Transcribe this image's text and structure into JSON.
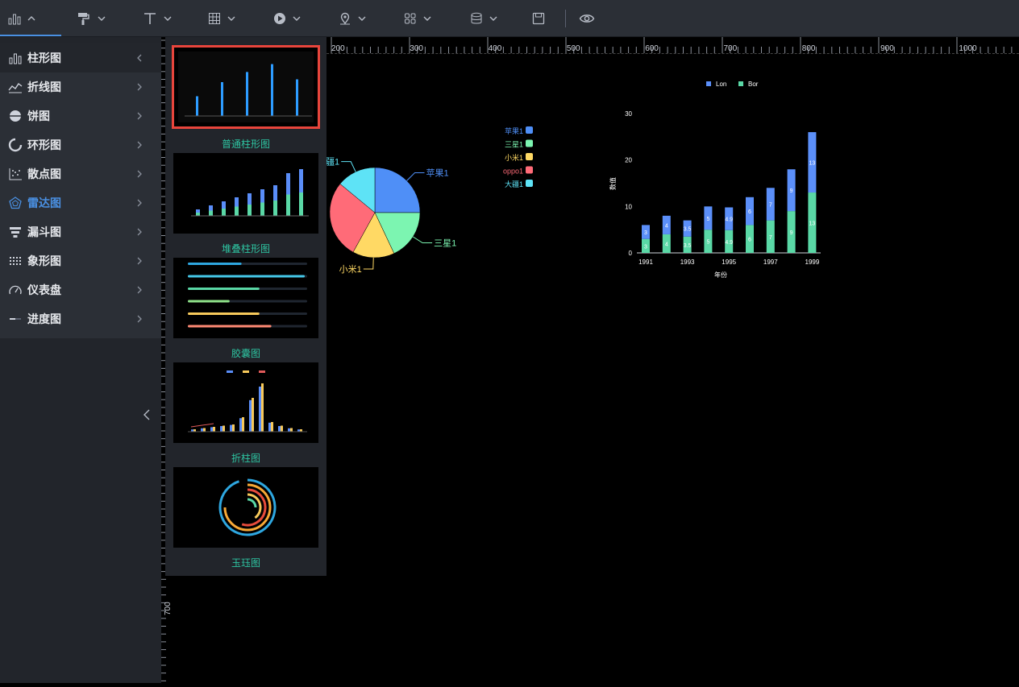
{
  "toolbar": {
    "items": [
      {
        "icon": "bar-chart-icon"
      },
      {
        "icon": "paint-roller-icon"
      },
      {
        "icon": "text-icon"
      },
      {
        "icon": "table-icon"
      },
      {
        "icon": "media-play-icon"
      },
      {
        "icon": "map-pin-icon"
      },
      {
        "icon": "grid-squares-icon"
      },
      {
        "icon": "database-icon"
      },
      {
        "icon": "save-icon"
      },
      {
        "icon": "preview-eye-icon"
      }
    ]
  },
  "sidebar": {
    "items": [
      {
        "label": "柱形图",
        "icon": "bar-icon"
      },
      {
        "label": "折线图",
        "icon": "line-icon"
      },
      {
        "label": "饼图",
        "icon": "pie-icon"
      },
      {
        "label": "环形图",
        "icon": "ring-icon"
      },
      {
        "label": "散点图",
        "icon": "scatter-icon"
      },
      {
        "label": "雷达图",
        "icon": "radar-icon"
      },
      {
        "label": "漏斗图",
        "icon": "funnel-icon"
      },
      {
        "label": "象形图",
        "icon": "pictorial-icon"
      },
      {
        "label": "仪表盘",
        "icon": "gauge-icon"
      },
      {
        "label": "进度图",
        "icon": "progress-icon"
      }
    ]
  },
  "panel": {
    "thumbs": [
      {
        "label": "普通柱形图"
      },
      {
        "label": "堆叠柱形图"
      },
      {
        "label": "胶囊图"
      },
      {
        "label": "折柱图"
      },
      {
        "label": "玉珏图"
      }
    ]
  },
  "ruler": {
    "top_labels": [
      "200",
      "300",
      "400",
      "500",
      "600",
      "700",
      "800",
      "900",
      "1000"
    ],
    "left_label": "700"
  },
  "canvas": {
    "pie": {
      "legend": [
        "苹果1",
        "三星1",
        "小米1",
        "oppo1",
        "大疆1"
      ],
      "slice_labels": [
        "苹果1",
        "三星1",
        "小米1",
        "疆1"
      ],
      "colors": [
        "#4f8ff7",
        "#7cf5b1",
        "#ffd964",
        "#ff6b78",
        "#5ee3f6"
      ]
    },
    "bar": {
      "legend": [
        "Lon",
        "Bor"
      ],
      "colors": [
        "#5b8ff9",
        "#5ad8a6"
      ],
      "ylabel": "数值",
      "xlabel": "年份"
    }
  },
  "chart_data": [
    {
      "type": "pie",
      "categories": [
        "苹果1",
        "三星1",
        "小米1",
        "oppo1",
        "大疆1"
      ],
      "values": [
        25,
        18,
        15,
        28,
        14
      ],
      "legend_position": "left"
    },
    {
      "type": "bar",
      "stacked": true,
      "categories": [
        "1991",
        "1992",
        "1993",
        "1994",
        "1995",
        "1996",
        "1997",
        "1998",
        "1999"
      ],
      "x_tick_labels": [
        "1991",
        "1993",
        "1995",
        "1997",
        "1999"
      ],
      "series": [
        {
          "name": "Bor",
          "values": [
            3,
            4,
            3.5,
            5,
            4.9,
            6,
            7,
            9,
            13
          ]
        },
        {
          "name": "Lon",
          "values": [
            3,
            4,
            3.5,
            5,
            4.9,
            6,
            7,
            9,
            13
          ]
        }
      ],
      "ylim": [
        0,
        30
      ],
      "y_ticks": [
        0,
        10,
        20,
        30
      ],
      "xlabel": "年份",
      "ylabel": "数值",
      "legend_position": "top"
    }
  ]
}
